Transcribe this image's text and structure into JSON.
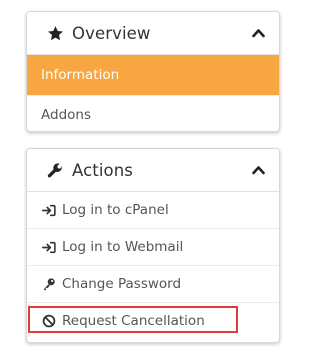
{
  "overview": {
    "title": "Overview",
    "icon": "star-icon",
    "toggle_icon": "chevron-up-icon",
    "items": [
      {
        "label": "Information",
        "active": true
      },
      {
        "label": "Addons",
        "active": false
      }
    ]
  },
  "actions": {
    "title": "Actions",
    "icon": "wrench-icon",
    "toggle_icon": "chevron-up-icon",
    "items": [
      {
        "label": "Log in to cPanel",
        "icon": "sign-in-icon"
      },
      {
        "label": "Log in to Webmail",
        "icon": "sign-in-icon"
      },
      {
        "label": "Change Password",
        "icon": "key-icon"
      },
      {
        "label": "Request Cancellation",
        "icon": "ban-icon",
        "highlighted": true
      }
    ]
  },
  "colors": {
    "active_background": "#f7a641",
    "highlight_border": "#e0393e",
    "text": "#555555",
    "heading": "#333333"
  }
}
